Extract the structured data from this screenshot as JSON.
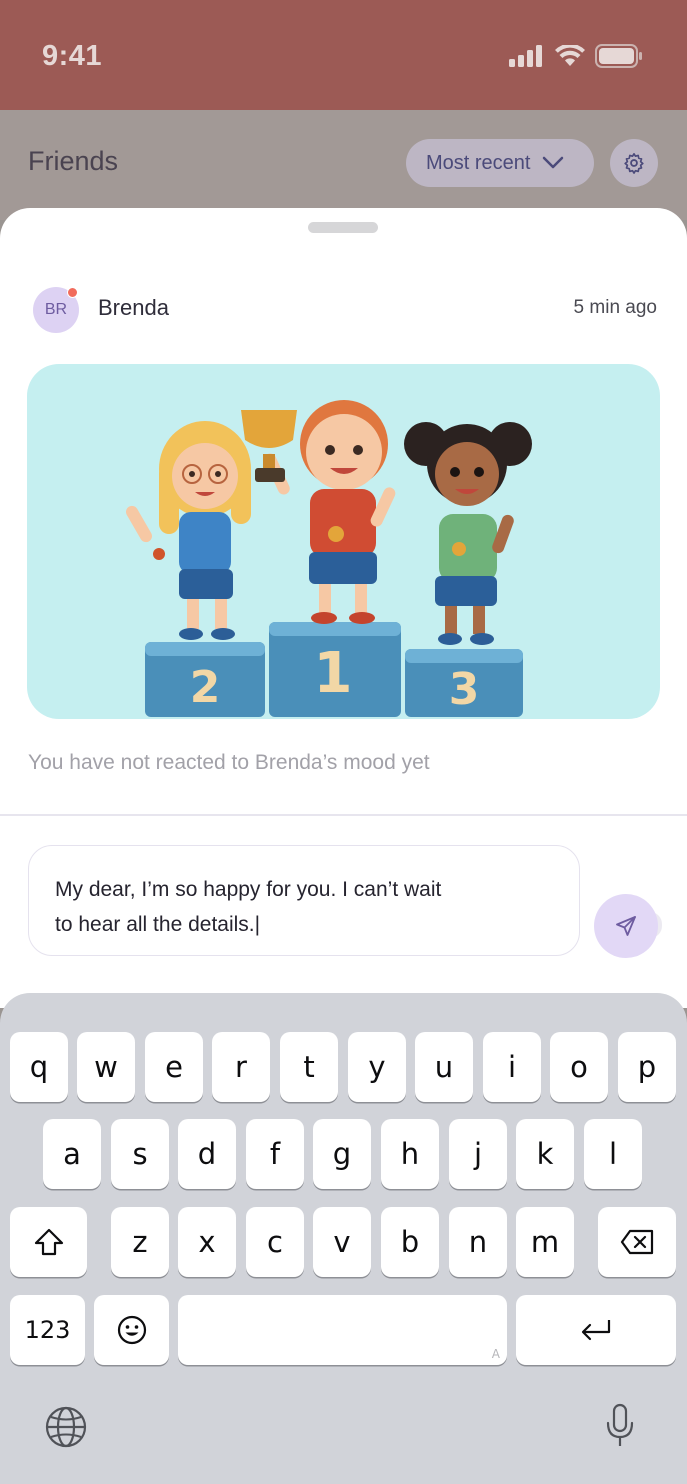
{
  "status": {
    "time": "9:41"
  },
  "header": {
    "title": "Friends",
    "sort_label": "Most recent"
  },
  "post": {
    "avatar_initials": "BR",
    "sender": "Brenda",
    "time_ago": "5 min ago",
    "podium_numbers": [
      "2",
      "1",
      "3"
    ],
    "reaction_note": "You have not reacted to Brenda’s mood yet"
  },
  "composer": {
    "message_line1": "My dear, I’m so happy for you. I can’t wait",
    "message_line2": "to hear all the details.|"
  },
  "keyboard": {
    "row1": [
      "q",
      "w",
      "e",
      "r",
      "t",
      "y",
      "u",
      "i",
      "o",
      "p"
    ],
    "row2": [
      "a",
      "s",
      "d",
      "f",
      "g",
      "h",
      "j",
      "k",
      "l"
    ],
    "row3": [
      "z",
      "x",
      "c",
      "v",
      "b",
      "n",
      "m"
    ],
    "numbers_label": "123",
    "space_hint": "A"
  },
  "colors": {
    "status_bar": "#9c5a55",
    "accent_purple": "#e2d8f6",
    "notification_dot": "#f16b5c",
    "image_bg": "#c5eff0",
    "keyboard_bg": "#d1d3d9"
  }
}
